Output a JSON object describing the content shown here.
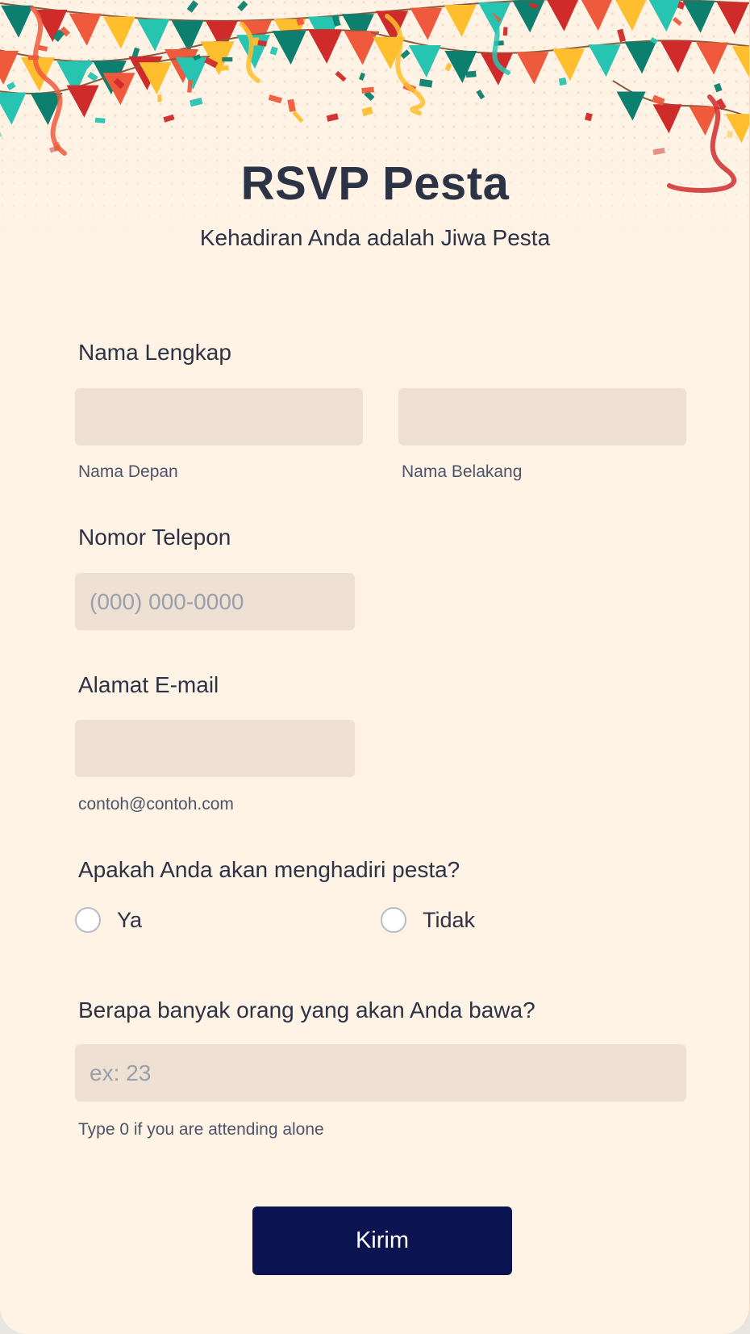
{
  "form": {
    "title": "RSVP Pesta",
    "subtitle": "Kehadiran Anda adalah Jiwa Pesta"
  },
  "name": {
    "label": "Nama Lengkap",
    "first_sublabel": "Nama Depan",
    "last_sublabel": "Nama Belakang",
    "first_value": "",
    "last_value": ""
  },
  "phone": {
    "label": "Nomor Telepon",
    "placeholder": "(000) 000-0000",
    "value": ""
  },
  "email": {
    "label": "Alamat E-mail",
    "sublabel": "contoh@contoh.com",
    "value": ""
  },
  "attendance": {
    "question": "Apakah Anda akan menghadiri pesta?",
    "options": [
      "Ya",
      "Tidak"
    ]
  },
  "guests": {
    "question": "Berapa banyak orang yang akan Anda bawa?",
    "placeholder": "ex: 23",
    "hint": "Type 0 if you are attending alone",
    "value": ""
  },
  "submit_label": "Kirim",
  "colors": {
    "background": "#fff3e6",
    "input_bg": "#eee0d3",
    "text": "#2c3345",
    "button": "#0b1450",
    "flag_red": "#cf2b2b",
    "flag_orange": "#ef5a3c",
    "flag_yellow": "#ffbe2e",
    "flag_teal": "#27c4b2",
    "flag_green": "#0d7f6f"
  }
}
